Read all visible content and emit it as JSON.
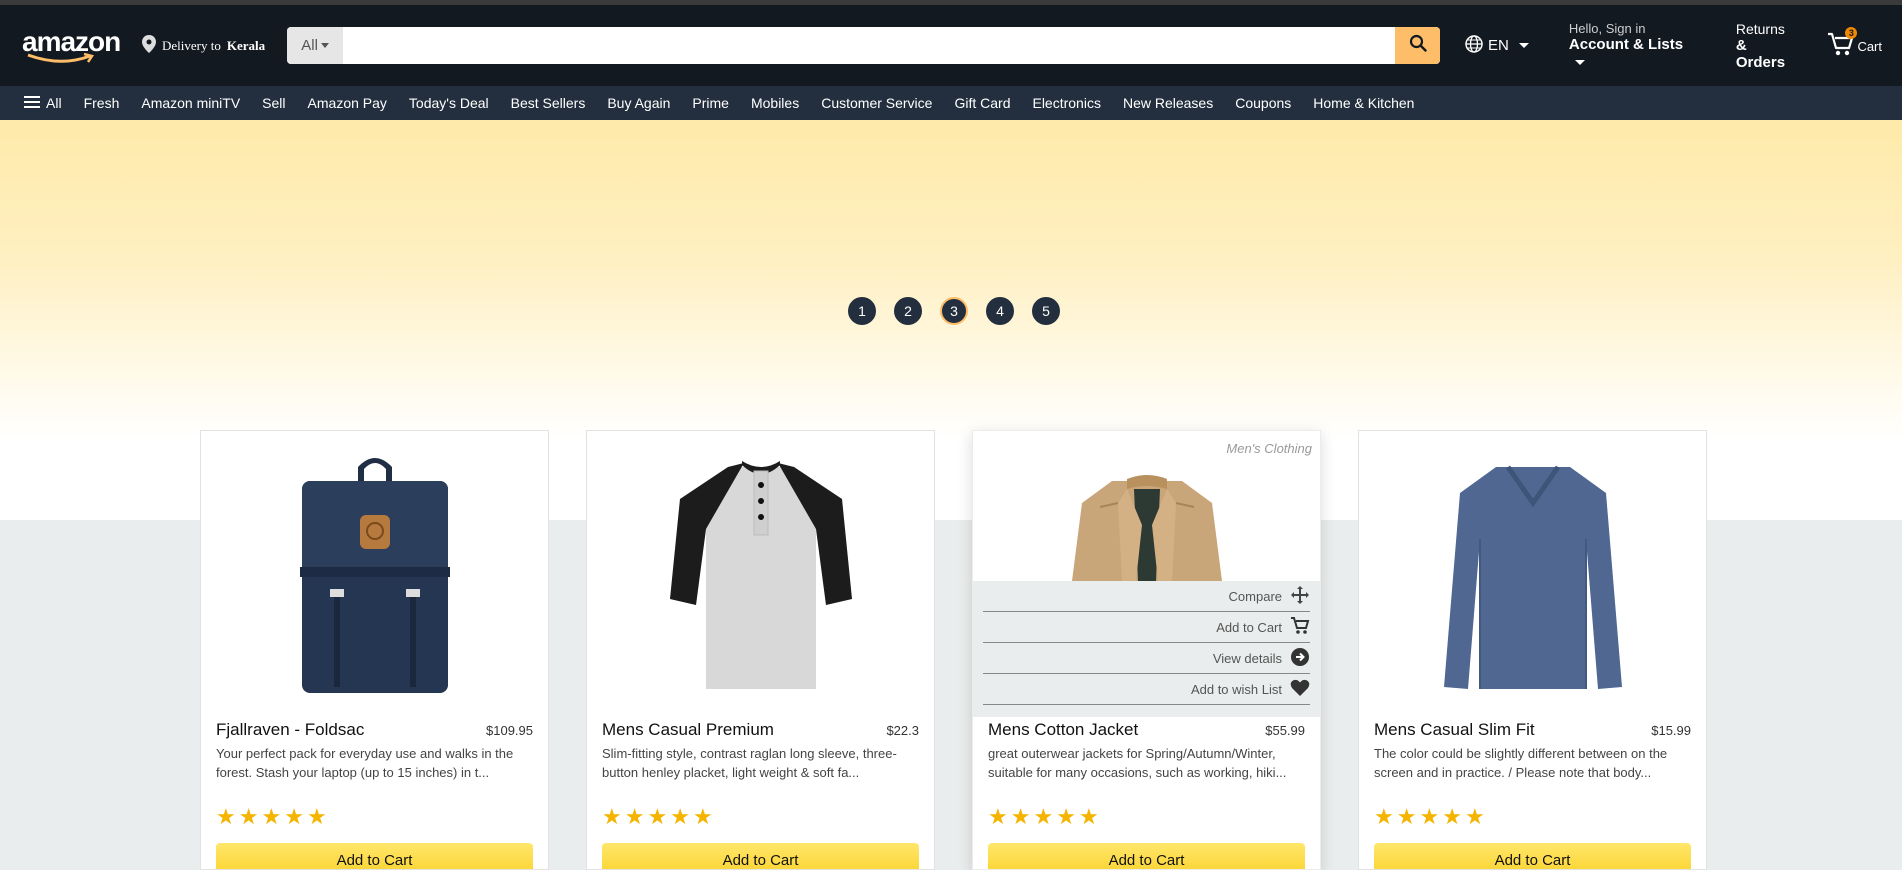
{
  "header": {
    "logo_text": "amazon",
    "deliver_prefix": "Delivery to",
    "deliver_location": "Kerala",
    "search_category": "All",
    "search_placeholder": "",
    "lang": "EN",
    "greeting": "Hello, Sign in",
    "account_label": "Account & Lists",
    "returns_small": "Returns",
    "returns_big": "& Orders",
    "cart_label": "Cart",
    "cart_count": "3"
  },
  "subnav": {
    "items": [
      "All",
      "Fresh",
      "Amazon miniTV",
      "Sell",
      "Amazon Pay",
      "Today's Deal",
      "Best Sellers",
      "Buy Again",
      "Prime",
      "Mobiles",
      "Customer Service",
      "Gift Card",
      "Electronics",
      "New Releases",
      "Coupons",
      "Home & Kitchen"
    ]
  },
  "carousel": {
    "pages": [
      "1",
      "2",
      "3",
      "4",
      "5"
    ],
    "active": 3
  },
  "products": [
    {
      "title": "Fjallraven - Foldsac",
      "price": "$109.95",
      "description": "Your perfect pack for everyday use and walks in the forest. Stash your laptop (up to 15 inches) in t...",
      "rating": 5,
      "button": "Add to Cart",
      "image": "backpack-image"
    },
    {
      "title": "Mens Casual Premium",
      "price": "$22.3",
      "description": "Slim-fitting style, contrast raglan long sleeve, three-button henley placket, light weight & soft fa...",
      "rating": 5,
      "button": "Add to Cart",
      "image": "henley-shirt-image"
    },
    {
      "title": "Mens Cotton Jacket",
      "price": "$55.99",
      "description": "great outerwear jackets for Spring/Autumn/Winter, suitable for many occasions, such as working, hiki...",
      "rating": 5,
      "button": "Add to Cart",
      "image": "jacket-image",
      "category": "Men's Clothing",
      "actions": [
        "Compare",
        "Add to Cart",
        "View details",
        "Add to wish List"
      ]
    },
    {
      "title": "Mens Casual Slim Fit",
      "price": "$15.99",
      "description": "The color could be slightly different between on the screen and in practice. / Please note that body...",
      "rating": 5,
      "button": "Add to Cart",
      "image": "tshirt-image"
    }
  ],
  "colors": {
    "nav_dark": "#131921",
    "subnav": "#232f3e",
    "accent": "#febd69",
    "star": "#f4b400"
  }
}
